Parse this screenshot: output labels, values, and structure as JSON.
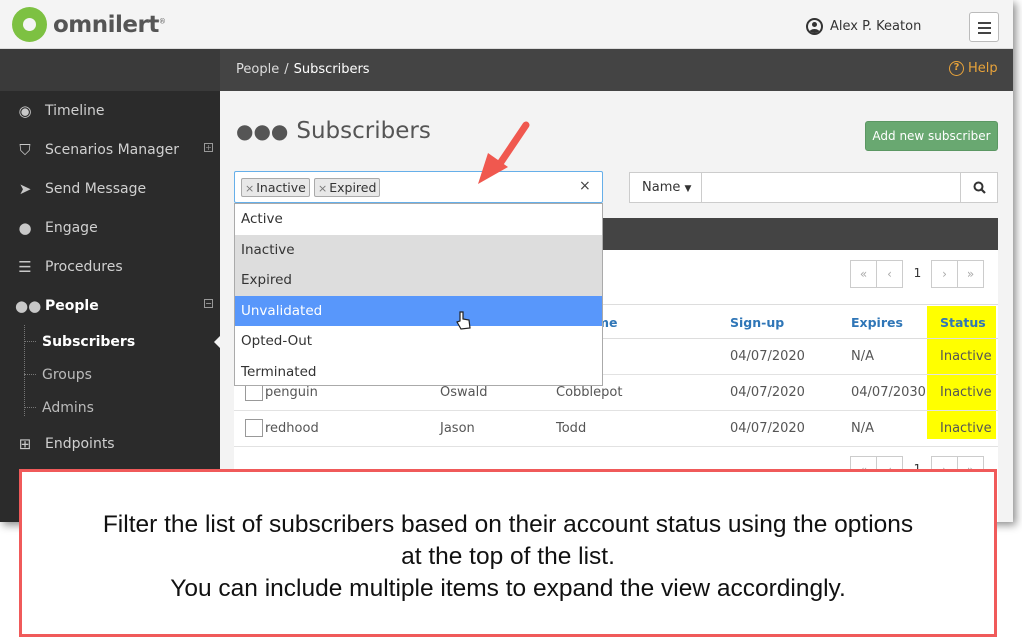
{
  "app": {
    "logo_text": "omnilert",
    "user_name": "Alex P. Keaton"
  },
  "sidebar": {
    "items": [
      {
        "label": "Timeline",
        "icon": "timeline-icon"
      },
      {
        "label": "Scenarios Manager",
        "icon": "shield-icon"
      },
      {
        "label": "Send Message",
        "icon": "paper-plane-icon"
      },
      {
        "label": "Engage",
        "icon": "chat-bubbles-icon"
      },
      {
        "label": "Procedures",
        "icon": "list-icon"
      },
      {
        "label": "People",
        "icon": "users-icon"
      }
    ],
    "people_sub": [
      {
        "label": "Subscribers"
      },
      {
        "label": "Groups"
      },
      {
        "label": "Admins"
      }
    ],
    "endpoints": {
      "label": "Endpoints",
      "icon": "sitemap-icon"
    }
  },
  "breadcrumb": {
    "parent": "People",
    "separator": "/",
    "current": "Subscribers",
    "help": "Help"
  },
  "main": {
    "title": "Subscribers",
    "add_button": "Add new subscriber",
    "filter": {
      "tags": [
        "Inactive",
        "Expired"
      ],
      "tag_remove": "×",
      "clear": "×"
    },
    "name_select": "Name",
    "dropdown_options": [
      {
        "label": "Active",
        "state": "normal"
      },
      {
        "label": "Inactive",
        "state": "selected"
      },
      {
        "label": "Expired",
        "state": "selected"
      },
      {
        "label": "Unvalidated",
        "state": "highlighted"
      },
      {
        "label": "Opted-Out",
        "state": "normal"
      },
      {
        "label": "Terminated",
        "state": "normal"
      }
    ],
    "pager": {
      "first": "«",
      "prev": "‹",
      "page": "1",
      "next": "›",
      "last": "»"
    },
    "table": {
      "headers": {
        "last_name_partial": "me",
        "signup": "Sign-up",
        "expires": "Expires",
        "status": "Status"
      },
      "rows": [
        {
          "username": "",
          "first": "",
          "last": "",
          "signup": "04/07/2020",
          "expires": "N/A",
          "status": "Inactive"
        },
        {
          "username": "penguin",
          "first": "Oswald",
          "last": "Cobblepot",
          "signup": "04/07/2020",
          "expires": "04/07/2030",
          "status": "Inactive"
        },
        {
          "username": "redhood",
          "first": "Jason",
          "last": "Todd",
          "signup": "04/07/2020",
          "expires": "N/A",
          "status": "Inactive"
        }
      ]
    }
  },
  "callout": {
    "line1": "Filter the list of subscribers based on their account status using the options",
    "line2": "at the top of the list.",
    "line3": "You can include multiple items to expand the view accordingly."
  },
  "colors": {
    "accent_green": "#69a871",
    "highlight_blue": "#5897fb",
    "status_highlight": "#ffff00",
    "callout_border": "#f05a5a",
    "help_orange": "#e8a33a"
  }
}
